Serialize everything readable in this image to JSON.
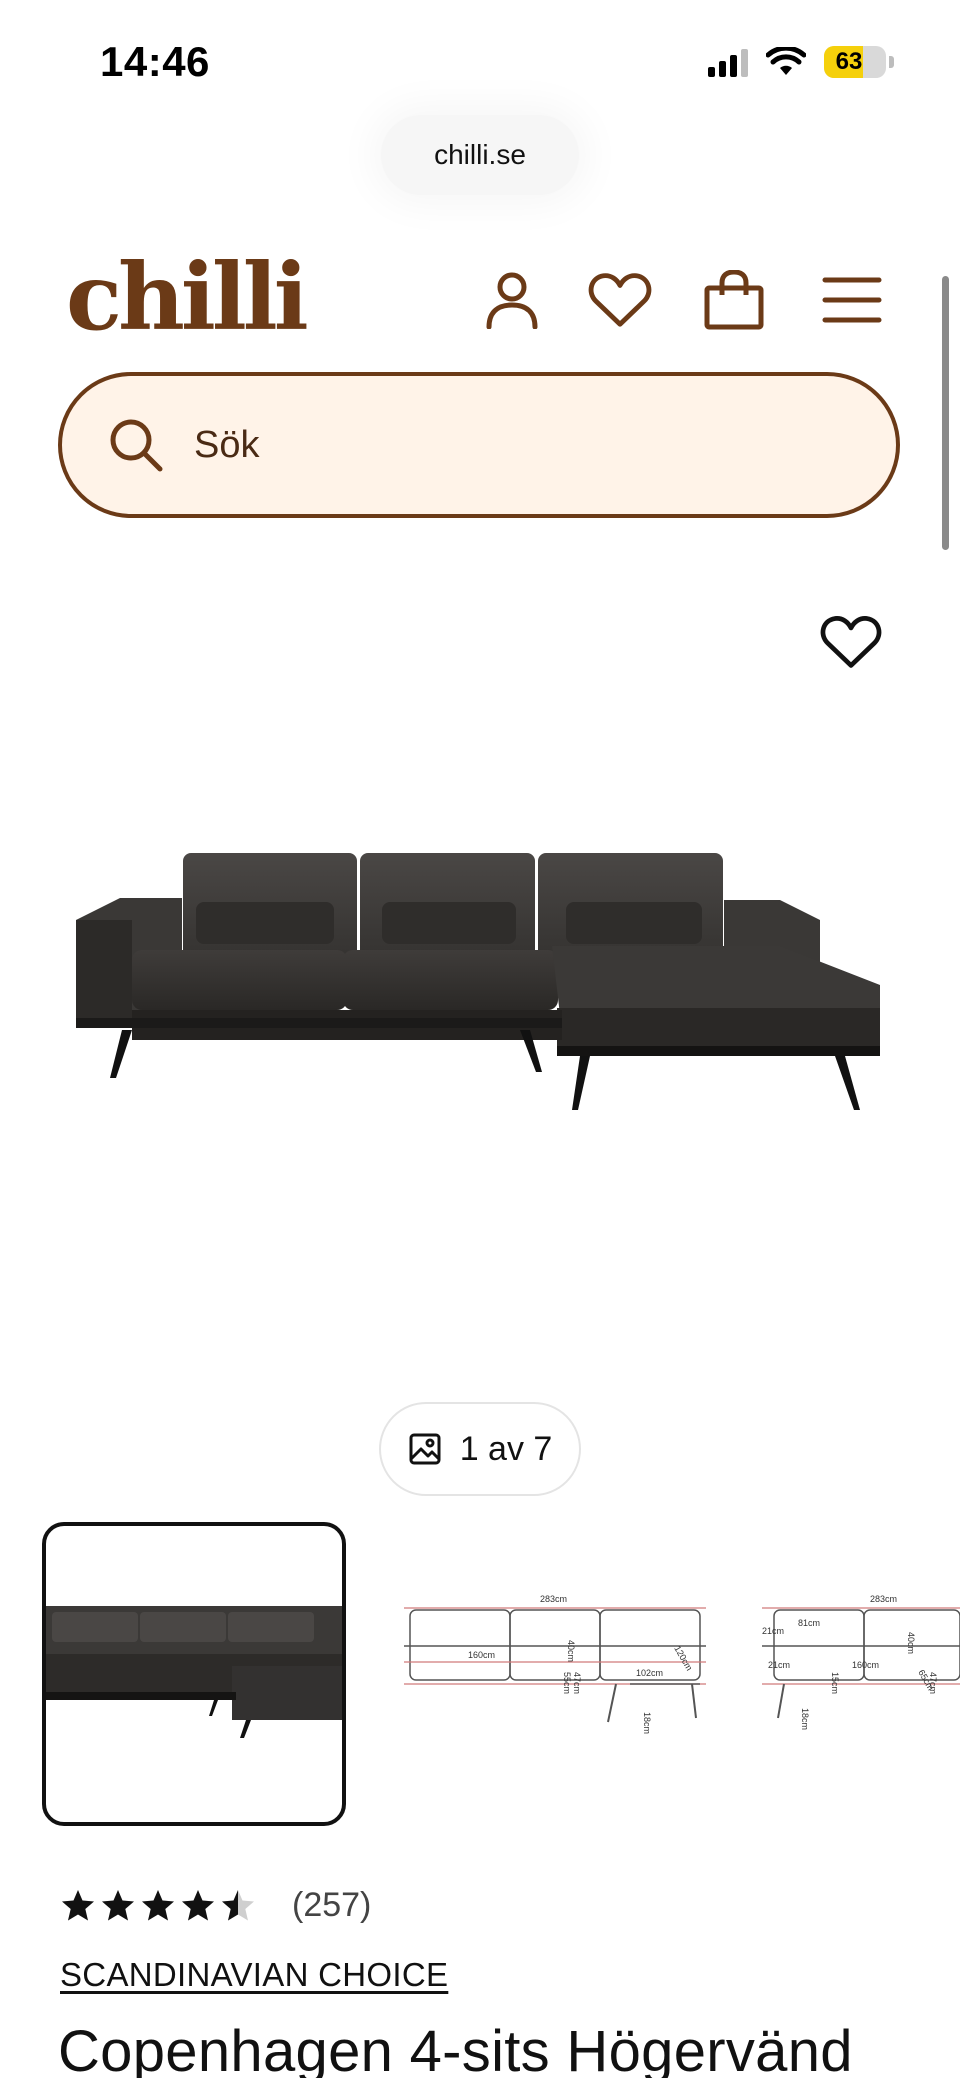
{
  "status_bar": {
    "time": "14:46",
    "battery_level": "63",
    "battery_fraction": 0.63,
    "battery_color": "#f5d00b"
  },
  "browser": {
    "url": "chilli.se"
  },
  "header": {
    "logo_text": "chilli",
    "brand_color": "#6b3a17",
    "icons": [
      "account-icon",
      "wishlist-icon",
      "cart-icon",
      "menu-icon"
    ]
  },
  "search": {
    "placeholder": "Sök",
    "background": "#fff3e8"
  },
  "gallery": {
    "counter_current": "1",
    "counter_text": "1 av 7",
    "total": 7,
    "thumbnails": [
      {
        "name": "sofa-photo",
        "active": true
      },
      {
        "name": "sofa-dimension-drawing-front",
        "active": false
      },
      {
        "name": "sofa-dimension-drawing-side",
        "active": false
      }
    ],
    "drawing_labels_1": [
      "283cm",
      "40cm",
      "55cm",
      "47cm",
      "160cm",
      "102cm",
      "120cm",
      "18cm"
    ],
    "drawing_labels_2": [
      "283cm",
      "81cm",
      "21cm",
      "160cm",
      "40cm",
      "15cm",
      "47cm",
      "18cm",
      "21cm",
      "65cm"
    ]
  },
  "product": {
    "rating": 4.5,
    "review_count": "(257)",
    "brand": "SCANDINAVIAN CHOICE",
    "title": "Copenhagen 4-sits Högervänd"
  }
}
